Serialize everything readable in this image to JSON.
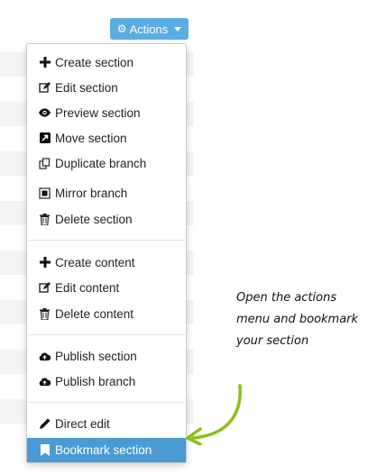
{
  "actions_button": {
    "label": "Actions",
    "icon": "gear-icon"
  },
  "menu": {
    "groups": [
      [
        {
          "label": "Create section",
          "icon": "plus-icon"
        },
        {
          "label": "Edit section",
          "icon": "edit-icon"
        },
        {
          "label": "Preview section",
          "icon": "eye-icon"
        },
        {
          "label": "Move section",
          "icon": "move-icon"
        },
        {
          "label": "Duplicate branch",
          "icon": "duplicate-icon"
        },
        {
          "label": "Mirror branch",
          "icon": "mirror-icon"
        },
        {
          "label": "Delete section",
          "icon": "trash-icon"
        }
      ],
      [
        {
          "label": "Create content",
          "icon": "plus-icon"
        },
        {
          "label": "Edit content",
          "icon": "edit-icon"
        },
        {
          "label": "Delete content",
          "icon": "trash-icon"
        }
      ],
      [
        {
          "label": "Publish section",
          "icon": "cloud-upload-icon"
        },
        {
          "label": "Publish branch",
          "icon": "cloud-upload-icon"
        }
      ],
      [
        {
          "label": "Direct edit",
          "icon": "pencil-icon"
        },
        {
          "label": "Bookmark section",
          "icon": "bookmark-icon",
          "highlighted": true
        }
      ]
    ]
  },
  "annotation": {
    "text": "Open the actions menu and bookmark your section"
  },
  "colors": {
    "button": "#5bace0",
    "highlight": "#4a9ad4",
    "arrow": "#8cbd1e"
  }
}
